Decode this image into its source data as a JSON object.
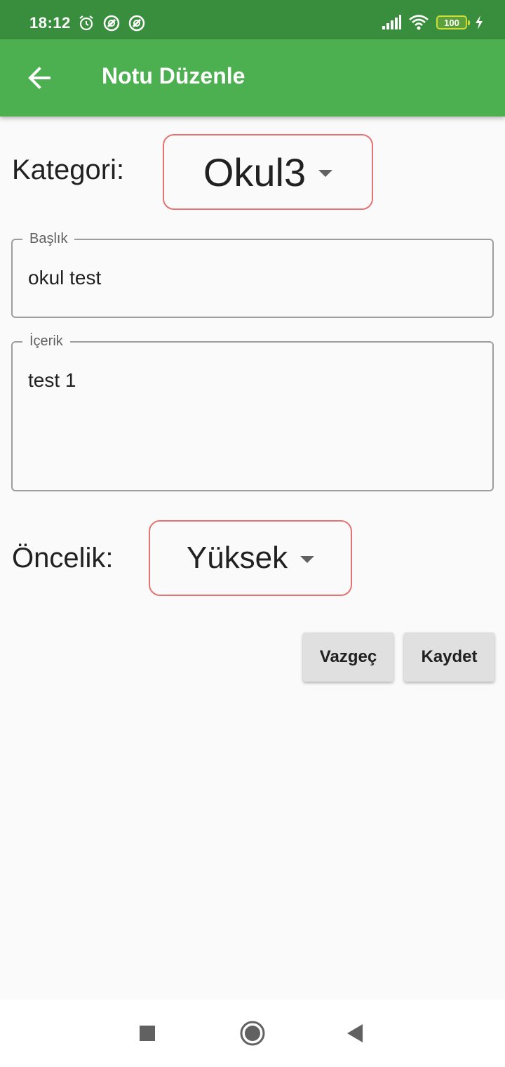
{
  "status_bar": {
    "time": "18:12",
    "battery": "100",
    "left_icons": [
      "alarm-icon",
      "vpn-icon",
      "vpn-icon"
    ],
    "right_icons": [
      "signal-icon",
      "wifi-icon",
      "battery-icon",
      "charging-icon"
    ]
  },
  "app_bar": {
    "title": "Notu Düzenle",
    "back_icon": "arrow-back-icon",
    "color": "#4caf50"
  },
  "form": {
    "category_label": "Kategori:",
    "category_value": "Okul3",
    "title_field": {
      "label": "Başlık",
      "value": "okul test"
    },
    "content_field": {
      "label": "İçerik",
      "value": "test 1"
    },
    "priority_label": "Öncelik:",
    "priority_value": "Yüksek",
    "dropdown_border_color": "#e57373"
  },
  "actions": {
    "cancel_label": "Vazgeç",
    "save_label": "Kaydet"
  },
  "nav_bar": {
    "icons": [
      "recents-square-icon",
      "home-circle-icon",
      "back-triangle-icon"
    ]
  }
}
